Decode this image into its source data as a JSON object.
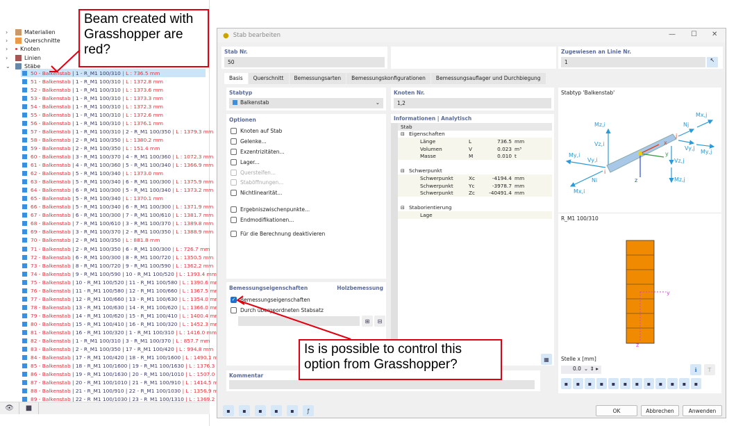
{
  "tree": {
    "top": [
      {
        "label": "Materialien",
        "icon": "materials-icon"
      },
      {
        "label": "Querschnitte",
        "icon": "sections-icon"
      },
      {
        "label": "Knoten",
        "icon": "node-icon"
      },
      {
        "label": "Linien",
        "icon": "line-icon"
      },
      {
        "label": "Stäbe",
        "icon": "member-icon"
      }
    ],
    "items": [
      [
        "50 - Balkenstab",
        "| 1 - R_M1 100/310",
        "| L : 736.5 mm"
      ],
      [
        "51 - Balkenstab",
        "| 1 - R_M1 100/310",
        "| L : 1372.8 mm"
      ],
      [
        "52 - Balkenstab",
        "| 1 - R_M1 100/310",
        "| L : 1373.6 mm"
      ],
      [
        "53 - Balkenstab",
        "| 1 - R_M1 100/310",
        "| L : 1373.3 mm"
      ],
      [
        "54 - Balkenstab",
        "| 1 - R_M1 100/310",
        "| L : 1372.3 mm"
      ],
      [
        "55 - Balkenstab",
        "| 1 - R_M1 100/310",
        "| L : 1372.6 mm"
      ],
      [
        "56 - Balkenstab",
        "| 1 - R_M1 100/310",
        "| L : 1376.1 mm"
      ],
      [
        "57 - Balkenstab",
        "| 1 - R_M1 100/310 | 2 - R_M1 100/350",
        "| L : 1379.3 mm"
      ],
      [
        "58 - Balkenstab",
        "| 2 - R_M1 100/350",
        "| L : 1380.2 mm"
      ],
      [
        "59 - Balkenstab",
        "| 2 - R_M1 100/350",
        "| L : 151.4 mm"
      ],
      [
        "60 - Balkenstab",
        "| 3 - R_M1 100/370 | 4 - R_M1 100/360",
        "| L : 1072.3 mm"
      ],
      [
        "61 - Balkenstab",
        "| 4 - R_M1 100/360 | 5 - R_M1 100/340",
        "| L : 1366.9 mm"
      ],
      [
        "62 - Balkenstab",
        "| 5 - R_M1 100/340",
        "| L : 1373.0 mm"
      ],
      [
        "63 - Balkenstab",
        "| 5 - R_M1 100/340 | 6 - R_M1 100/300",
        "| L : 1375.9 mm"
      ],
      [
        "64 - Balkenstab",
        "| 6 - R_M1 100/300 | 5 - R_M1 100/340",
        "| L : 1373.2 mm"
      ],
      [
        "65 - Balkenstab",
        "| 5 - R_M1 100/340",
        "| L : 1370.1 mm"
      ],
      [
        "66 - Balkenstab",
        "| 5 - R_M1 100/340 | 6 - R_M1 100/300",
        "| L : 1371.9 mm"
      ],
      [
        "67 - Balkenstab",
        "| 6 - R_M1 100/300 | 7 - R_M1 100/610",
        "| L : 1381.7 mm"
      ],
      [
        "68 - Balkenstab",
        "| 7 - R_M1 100/610 | 3 - R_M1 100/370",
        "| L : 1389.8 mm"
      ],
      [
        "69 - Balkenstab",
        "| 3 - R_M1 100/370 | 2 - R_M1 100/350",
        "| L : 1388.9 mm"
      ],
      [
        "70 - Balkenstab",
        "| 2 - R_M1 100/350",
        "| L : 881.8 mm"
      ],
      [
        "71 - Balkenstab",
        "| 2 - R_M1 100/350 | 6 - R_M1 100/300",
        "| L : 726.7 mm"
      ],
      [
        "72 - Balkenstab",
        "| 6 - R_M1 100/300 | 8 - R_M1 100/720",
        "| L : 1350.5 mm"
      ],
      [
        "73 - Balkenstab",
        "| 8 - R_M1 100/720 | 9 - R_M1 100/590",
        "| L : 1362.2 mm"
      ],
      [
        "74 - Balkenstab",
        "| 9 - R_M1 100/590 | 10 - R_M1 100/520",
        "| L : 1393.4 mm"
      ],
      [
        "75 - Balkenstab",
        "| 10 - R_M1 100/520 | 11 - R_M1 100/580",
        "| L : 1390.6 mm"
      ],
      [
        "76 - Balkenstab",
        "| 11 - R_M1 100/580 | 12 - R_M1 100/660",
        "| L : 1367.5 mm"
      ],
      [
        "77 - Balkenstab",
        "| 12 - R_M1 100/660 | 13 - R_M1 100/630",
        "| L : 1354.0 mm"
      ],
      [
        "78 - Balkenstab",
        "| 13 - R_M1 100/630 | 14 - R_M1 100/620",
        "| L : 1366.0 mm"
      ],
      [
        "79 - Balkenstab",
        "| 14 - R_M1 100/620 | 15 - R_M1 100/410",
        "| L : 1400.4 mm"
      ],
      [
        "80 - Balkenstab",
        "| 15 - R_M1 100/410 | 16 - R_M1 100/320",
        "| L : 1452.3 mm"
      ],
      [
        "81 - Balkenstab",
        "| 16 - R_M1 100/320 | 1 - R_M1 100/310",
        "| L : 1416.0 mm"
      ],
      [
        "82 - Balkenstab",
        "| 1 - R_M1 100/310 | 3 - R_M1 100/370",
        "| L : 857.7 mm"
      ],
      [
        "83 - Balkenstab",
        "| 2 - R_M1 100/350 | 17 - R_M1 100/420",
        "| L : 994.8 mm"
      ],
      [
        "84 - Balkenstab",
        "| 17 - R_M1 100/420 | 18 - R_M1 100/1600",
        "| L : 1490.1 mm"
      ],
      [
        "85 - Balkenstab",
        "| 18 - R_M1 100/1600 | 19 - R_M1 100/1630",
        "| L : 1376.3 mm"
      ],
      [
        "86 - Balkenstab",
        "| 19 - R_M1 100/1630 | 20 - R_M1 100/1010",
        "| L : 1507.0 mm"
      ],
      [
        "87 - Balkenstab",
        "| 20 - R_M1 100/1010 | 21 - R_M1 100/910",
        "| L : 1414.5 mm"
      ],
      [
        "88 - Balkenstab",
        "| 21 - R_M1 100/910 | 22 - R_M1 100/1030",
        "| L : 1356.9 mm"
      ],
      [
        "89 - Balkenstab",
        "| 22 - R_M1 100/1030 | 23 - R_M1 100/1310",
        "| L : 1369.2 mm"
      ]
    ]
  },
  "callouts": {
    "top": "Beam created with Grasshopper are red?",
    "bottom": "Is is possible to control this option from Grasshopper?"
  },
  "dialog": {
    "title": "Stab bearbeiten",
    "stab_nr_label": "Stab Nr.",
    "stab_nr": "50",
    "assigned_label": "Zugewiesen an Linie Nr.",
    "assigned": "1",
    "tabs": [
      "Basis",
      "Querschnitt",
      "Bemessungsarten",
      "Bemessungskonfigurationen",
      "Bemessungsauflager und Durchbiegung"
    ],
    "stabtyp_label": "Stabtyp",
    "stabtyp": "Balkenstab",
    "optionen_label": "Optionen",
    "options": [
      {
        "label": "Knoten auf Stab",
        "checked": false,
        "disabled": false
      },
      {
        "label": "Gelenke...",
        "checked": false,
        "disabled": false
      },
      {
        "label": "Exzentrizitäten...",
        "checked": false,
        "disabled": false
      },
      {
        "label": "Lager...",
        "checked": false,
        "disabled": false
      },
      {
        "label": "Quersteifen...",
        "checked": false,
        "disabled": true
      },
      {
        "label": "Staböffnungen...",
        "checked": false,
        "disabled": true
      },
      {
        "label": "Nichtlinearität...",
        "checked": false,
        "disabled": false
      },
      {
        "label": "Ergebniszwischenpunkte...",
        "checked": false,
        "disabled": false
      },
      {
        "label": "Endmodifikationen...",
        "checked": false,
        "disabled": false
      },
      {
        "label": "Für die Berechnung deaktivieren",
        "checked": false,
        "disabled": false
      }
    ],
    "design_label": "Bemessungseigenschaften",
    "design_right": "Holzbemessung",
    "design_options": [
      {
        "label": "Bemessungseigenschaften",
        "checked": true
      },
      {
        "label": "Durch übergeordneten Stabsatz",
        "checked": false
      }
    ],
    "kommentar_label": "Kommentar",
    "knoten_label": "Knoten Nr.",
    "knoten": "1,2",
    "info_label": "Informationen | Analytisch",
    "info_rows": [
      {
        "indent": 0,
        "name": "Stab",
        "head": true
      },
      {
        "indent": 1,
        "name": "Eigenschaften",
        "head": true
      },
      {
        "indent": 2,
        "name": "Länge",
        "sym": "L",
        "val": "736.5",
        "unit": "mm"
      },
      {
        "indent": 2,
        "name": "Volumen",
        "sym": "V",
        "val": "0.023",
        "unit": "m³"
      },
      {
        "indent": 2,
        "name": "Masse",
        "sym": "M",
        "val": "0.010",
        "unit": "t"
      },
      {
        "indent": 2,
        "name": "",
        "blank": true
      },
      {
        "indent": 1,
        "name": "Schwerpunkt",
        "head": true
      },
      {
        "indent": 2,
        "name": "Schwerpunkt",
        "sym": "Xc",
        "val": "-4194.4",
        "unit": "mm"
      },
      {
        "indent": 2,
        "name": "Schwerpunkt",
        "sym": "Yc",
        "val": "-3978.7",
        "unit": "mm"
      },
      {
        "indent": 2,
        "name": "Schwerpunkt",
        "sym": "Zc",
        "val": "-40491.4",
        "unit": "mm"
      },
      {
        "indent": 2,
        "name": "",
        "blank": true
      },
      {
        "indent": 1,
        "name": "Staborientierung",
        "head": true
      },
      {
        "indent": 2,
        "name": "Lage",
        "sym": "",
        "val": "",
        "unit": ""
      }
    ],
    "graphic_title": "Stabtyp 'Balkenstab'",
    "force_labels": {
      "mzi": "Mz,i",
      "vzi": "Vz,i",
      "myi": "My,i",
      "vyi": "Vy,i",
      "ni": "Ni",
      "mxi": "Mx,i",
      "i": "i",
      "j": "j",
      "nj": "Nj",
      "mxj": "Mx,j",
      "vyj": "Vy,j",
      "myj": "My,j",
      "vzj": "Vz,j",
      "mzj": "Mz,j",
      "x": "x",
      "y": "y",
      "z": "z"
    },
    "section_name": "R_M1 100/310",
    "section_axes": {
      "y": "y",
      "z": "z"
    },
    "stelle_label": "Stelle x [mm]",
    "stelle": "0.0",
    "buttons": {
      "ok": "OK",
      "cancel": "Abbrechen",
      "apply": "Anwenden"
    },
    "colors": {
      "red_text": "#e8303a",
      "accent": "#1f6fd1",
      "section": "#f08a00"
    }
  }
}
